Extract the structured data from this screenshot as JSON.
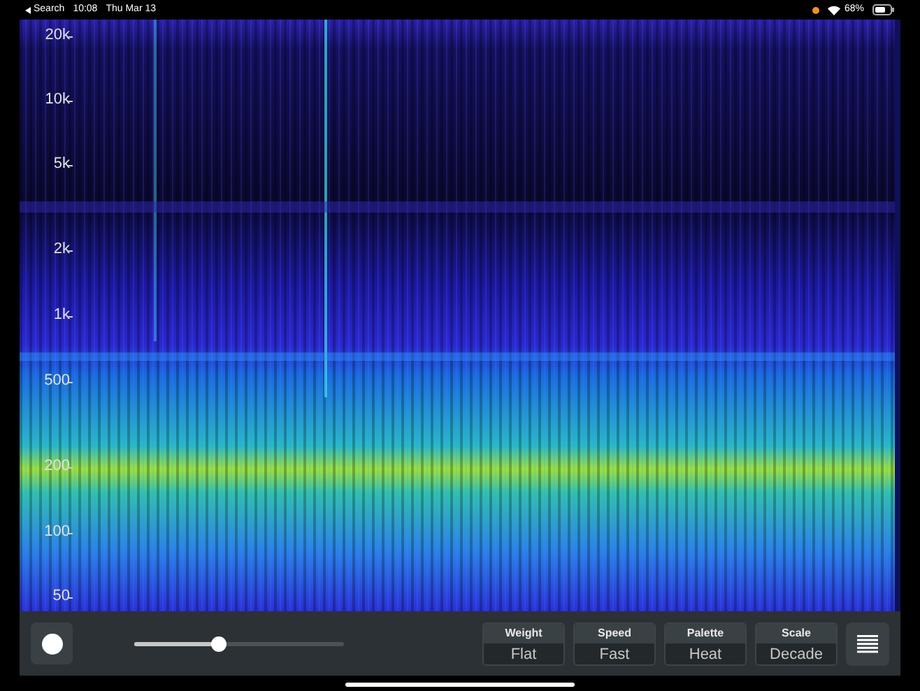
{
  "status_bar": {
    "back_label": "Search",
    "time": "10:08",
    "date": "Thu Mar 13",
    "battery": "68%"
  },
  "spectrogram": {
    "axis_labels": [
      "20k",
      "10k",
      "5k",
      "2k",
      "1k",
      "500",
      "200",
      "100",
      "50"
    ]
  },
  "controls": {
    "record": {
      "on": false
    },
    "slider": {
      "level": 0.4
    },
    "options": [
      {
        "label": "Weight",
        "value": "Flat"
      },
      {
        "label": "Speed",
        "value": "Fast"
      },
      {
        "label": "Palette",
        "value": "Heat"
      },
      {
        "label": "Scale",
        "value": "Decade"
      }
    ]
  }
}
